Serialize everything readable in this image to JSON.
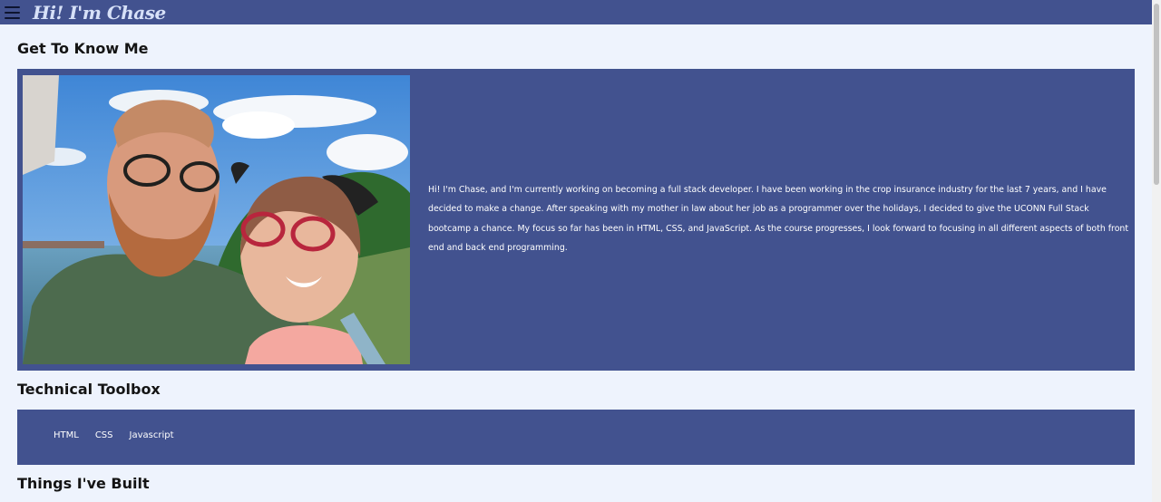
{
  "header": {
    "title": "Hi! I'm Chase",
    "menu_icon": "hamburger-menu-icon"
  },
  "sections": {
    "about": {
      "heading": "Get To Know Me",
      "photo_icon": "profile-photo",
      "text": "Hi! I'm Chase, and I'm currently working on becoming a full stack developer. I have been working in the crop insurance industry for the last 7 years, and I have decided to make a change. After speaking with my mother in law about her job as a programmer over the holidays, I decided to give the UCONN Full Stack bootcamp a chance. My focus so far has been in HTML, CSS, and JavaScript. As the course progresses, I look forward to focusing in all different aspects of both front end and back end programming."
    },
    "toolbox": {
      "heading": "Technical Toolbox",
      "tools": [
        "HTML",
        "CSS",
        "Javascript"
      ]
    },
    "projects": {
      "heading": "Things I've Built"
    }
  },
  "colors": {
    "panel": "#42528f",
    "background": "#eef3fd",
    "title": "#d7e1f8"
  }
}
